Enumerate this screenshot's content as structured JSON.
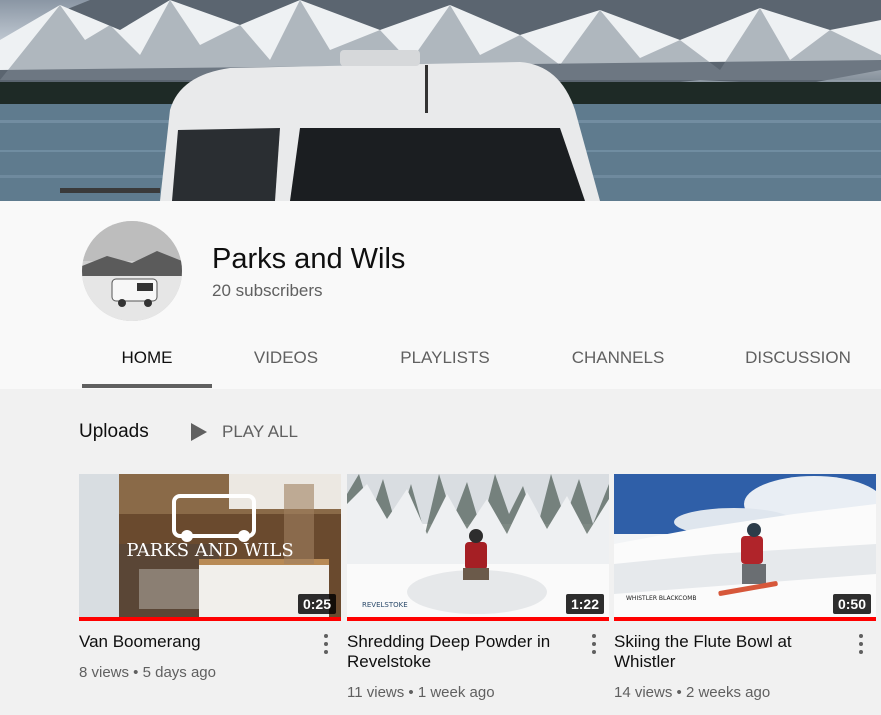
{
  "channel": {
    "name": "Parks and Wils",
    "subscribers": "20 subscribers"
  },
  "tabs": [
    {
      "label": "HOME",
      "active": true
    },
    {
      "label": "VIDEOS",
      "active": false
    },
    {
      "label": "PLAYLISTS",
      "active": false
    },
    {
      "label": "CHANNELS",
      "active": false
    },
    {
      "label": "DISCUSSION",
      "active": false
    }
  ],
  "uploads": {
    "title": "Uploads",
    "play_all": "PLAY ALL",
    "videos": [
      {
        "title": "Van Boomerang",
        "duration": "0:25",
        "meta": "8 views • 5 days ago",
        "watch_progress": 1.0,
        "thumb_text": "PARKS AND WILS"
      },
      {
        "title": "Shredding Deep Powder in Revelstoke",
        "duration": "1:22",
        "meta": "11 views • 1 week ago",
        "watch_progress": 1.0,
        "thumb_text": "REVELSTOKE"
      },
      {
        "title": "Skiing the Flute Bowl at Whistler",
        "duration": "0:50",
        "meta": "14 views • 2 weeks ago",
        "watch_progress": 1.0,
        "thumb_text": "WHISTLER BLACKCOMB"
      }
    ]
  },
  "colors": {
    "progress": "#ff0000",
    "text_primary": "#0f0f0f",
    "text_secondary": "#606060",
    "page_bg": "#f1f1f1",
    "header_bg": "#f9f9f9"
  },
  "icons": {
    "play_all": "play-icon",
    "more": "more-vertical-icon"
  }
}
